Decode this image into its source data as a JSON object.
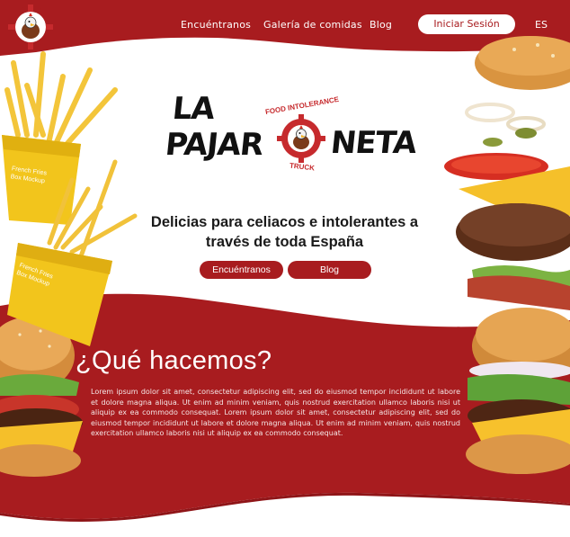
{
  "nav": {
    "links": [
      {
        "label": "Encuéntranos"
      },
      {
        "label": "Galería de comidas"
      },
      {
        "label": "Blog"
      }
    ],
    "login_label": "Iniciar Sesión",
    "language": "ES"
  },
  "brand": {
    "word_1": "LA",
    "word_2": "PAJAR",
    "word_3": "NETA",
    "badge_top": "FOOD INTOLERANCE",
    "badge_bottom": "TRUCK"
  },
  "hero": {
    "tagline": "Delicias para celiacos e intolerantes a través de toda España",
    "buttons": [
      {
        "label": "Encuéntranos"
      },
      {
        "label": "Blog"
      }
    ],
    "fries_label_1": "French Fries",
    "fries_sub_1": "Box Mockup",
    "fries_label_2": "French Fries",
    "fries_sub_2": "Box Mockup"
  },
  "section": {
    "title": "¿Qué hacemos?",
    "body": "Lorem ipsum dolor sit amet, consectetur adipiscing elit, sed do eiusmod tempor incididunt ut labore et dolore magna aliqua. Ut enim ad minim veniam, quis nostrud exercitation ullamco laboris nisi ut aliquip ex ea commodo consequat. Lorem ipsum dolor sit amet, consectetur adipiscing elit, sed do eiusmod tempor incididunt ut labore et dolore magna aliqua. Ut enim ad minim veniam, quis nostrud exercitation ullamco laboris nisi ut aliquip ex ea commodo consequat."
  },
  "colors": {
    "brand_red": "#a81c1f",
    "dark_red": "#8f1518",
    "fries_yellow": "#f2c51c"
  },
  "icons": {
    "logo": "rooster-gear-icon",
    "burger": "burger-image",
    "fries": "fries-box-image"
  }
}
